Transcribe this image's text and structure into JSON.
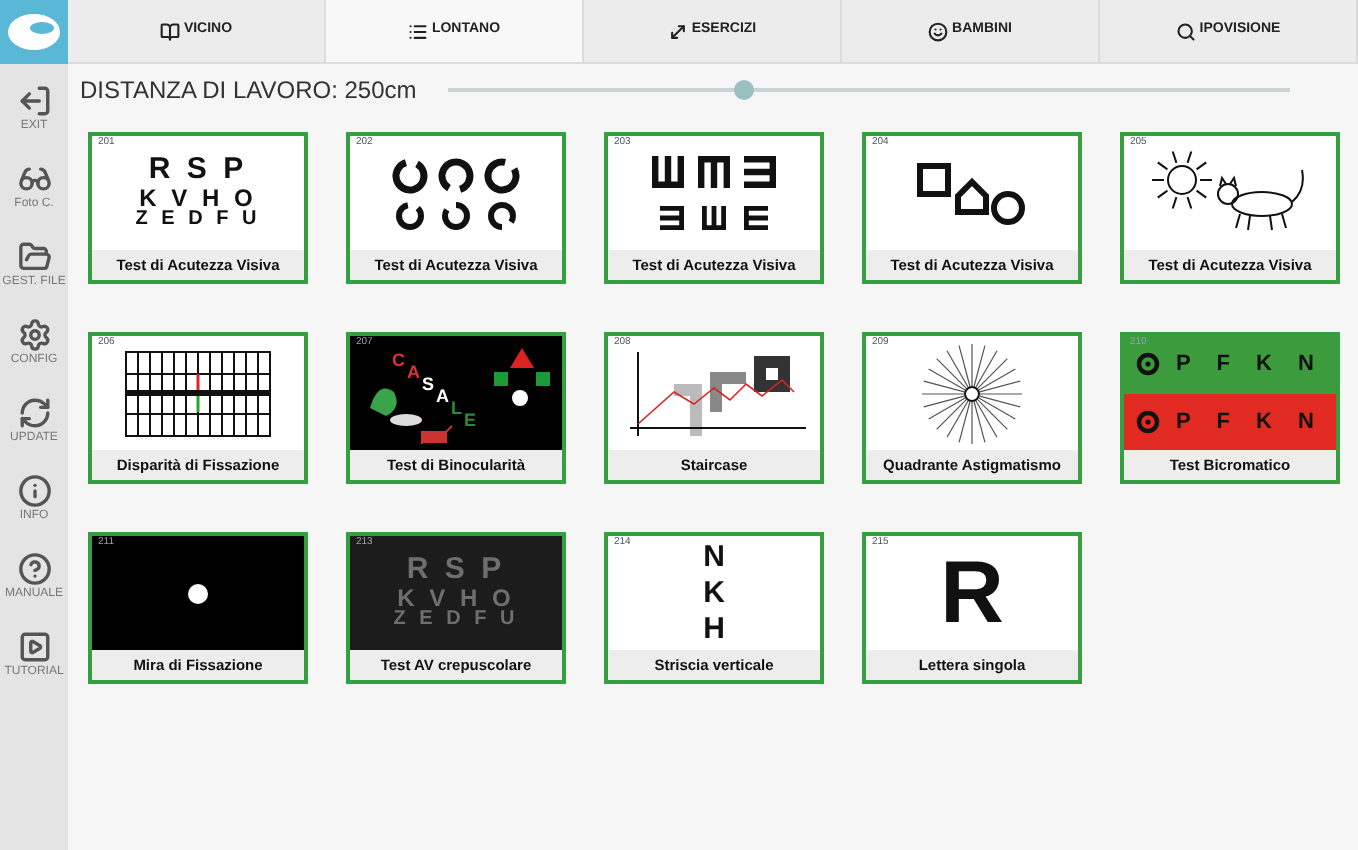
{
  "tabs": [
    {
      "label": "VICINO",
      "selected": false
    },
    {
      "label": "LONTANO",
      "selected": true
    },
    {
      "label": "ESERCIZI",
      "selected": false
    },
    {
      "label": "BAMBINI",
      "selected": false
    },
    {
      "label": "IPOVISIONE",
      "selected": false
    }
  ],
  "sidebar": {
    "items": [
      {
        "label": "EXIT"
      },
      {
        "label": "Foto C."
      },
      {
        "label": "GEST. FILE"
      },
      {
        "label": "CONFIG"
      },
      {
        "label": "UPDATE"
      },
      {
        "label": "INFO"
      },
      {
        "label": "MANUALE"
      },
      {
        "label": "TUTORIAL"
      }
    ]
  },
  "distance": {
    "label": "DISTANZA DI LAVORO: 250cm",
    "level": 0.35
  },
  "cards": [
    {
      "number": "201",
      "label": "Test di Acutezza Visiva",
      "kind": "letters",
      "lines": [
        "R S P",
        "K V H O",
        "Z E D F U"
      ]
    },
    {
      "number": "202",
      "label": "Test di Acutezza Visiva",
      "kind": "landolt"
    },
    {
      "number": "203",
      "label": "Test di Acutezza Visiva",
      "kind": "tumbling-e"
    },
    {
      "number": "204",
      "label": "Test di Acutezza Visiva",
      "kind": "shapes"
    },
    {
      "number": "205",
      "label": "Test di Acutezza Visiva",
      "kind": "sun-cat"
    },
    {
      "number": "206",
      "label": "Disparità di Fissazione",
      "kind": "grid"
    },
    {
      "number": "207",
      "label": "Test di Binocularità",
      "kind": "binocular",
      "lines": [
        "C",
        "A",
        "S",
        "A",
        "L",
        "E"
      ]
    },
    {
      "number": "208",
      "label": "Staircase",
      "kind": "staircase"
    },
    {
      "number": "209",
      "label": "Quadrante Astigmatismo",
      "kind": "astigmatism"
    },
    {
      "number": "210",
      "label": "Test Bicromatico",
      "kind": "bichromatic",
      "lines": [
        "P F K N",
        "P F K N"
      ]
    },
    {
      "number": "211",
      "label": "Mira di Fissazione",
      "kind": "fixation"
    },
    {
      "number": "213",
      "label": "Test AV crepuscolare",
      "kind": "letters-dark",
      "lines": [
        "R S P",
        "K V H O",
        "Z E D F U"
      ]
    },
    {
      "number": "214",
      "label": "Striscia verticale",
      "kind": "vertical",
      "lines": [
        "N",
        "K",
        "H"
      ]
    },
    {
      "number": "215",
      "label": "Lettera singola",
      "kind": "single",
      "lines": [
        "R"
      ]
    }
  ]
}
